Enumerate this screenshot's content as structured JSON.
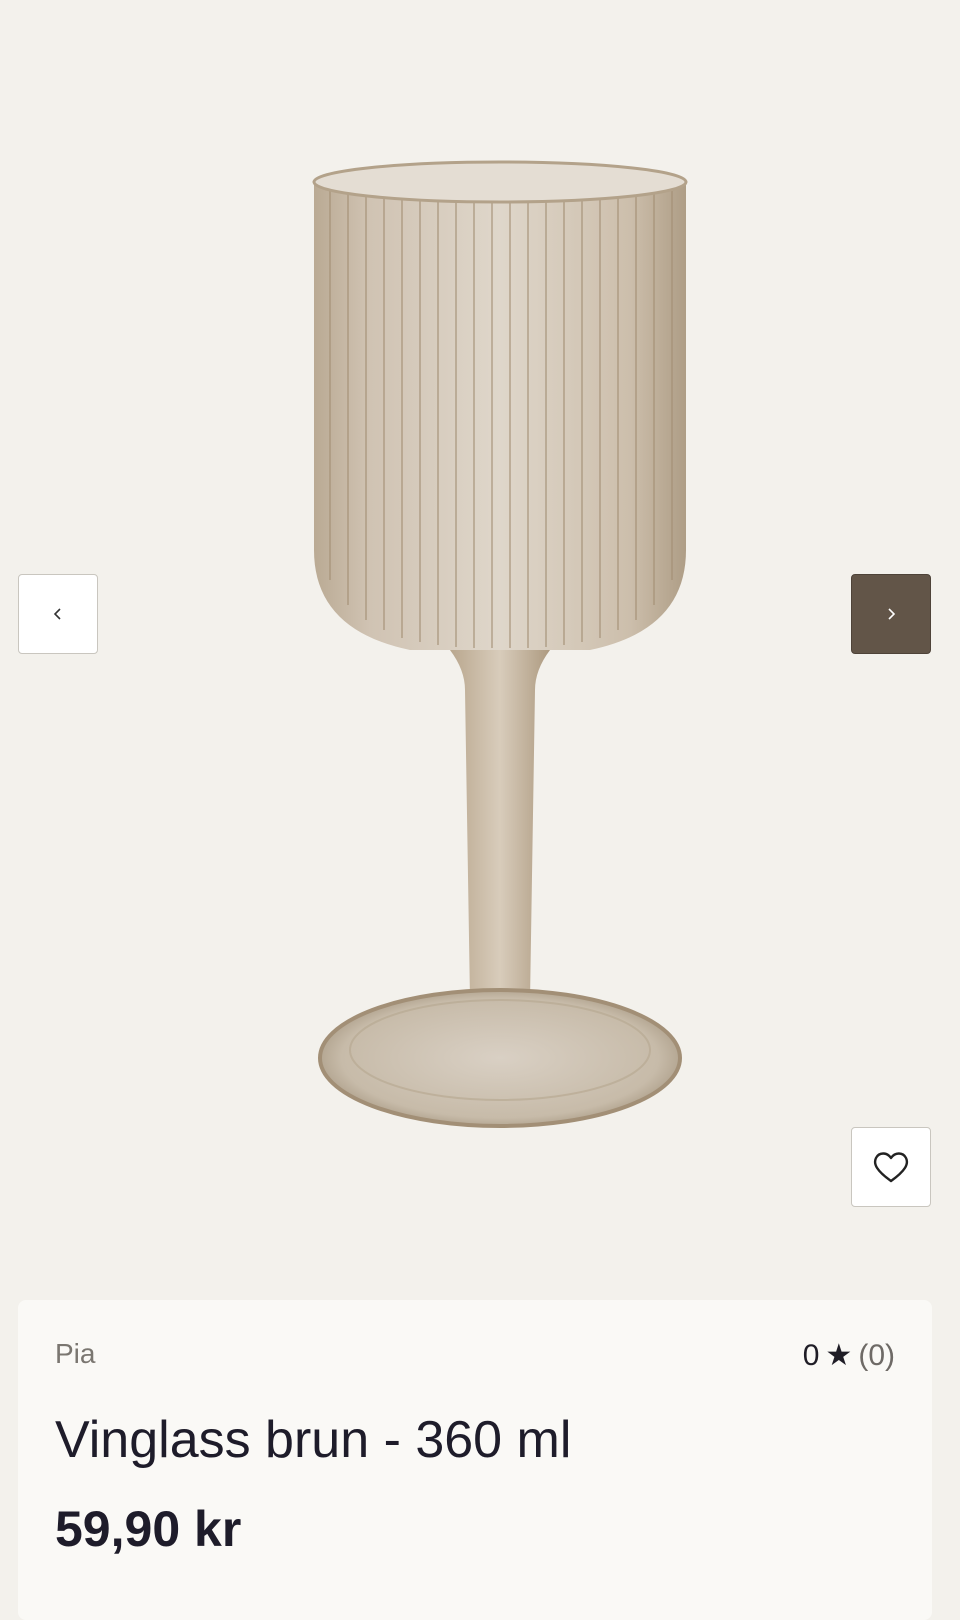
{
  "gallery": {
    "image_subject": "ribbed wine glass, brown tint",
    "prev_icon": "chevron-left-icon",
    "next_icon": "chevron-right-icon",
    "favorite_icon": "heart-icon"
  },
  "product": {
    "brand": "Pia",
    "rating_value": "0",
    "rating_star": "★",
    "rating_count": "(0)",
    "title": "Vinglass brun - 360 ml",
    "price": "59,90 kr"
  },
  "colors": {
    "background": "#f3f1ec",
    "card": "#faf9f6",
    "next_button": "#625548",
    "text_dark": "#1e1c2a",
    "text_muted": "#7a7670"
  }
}
